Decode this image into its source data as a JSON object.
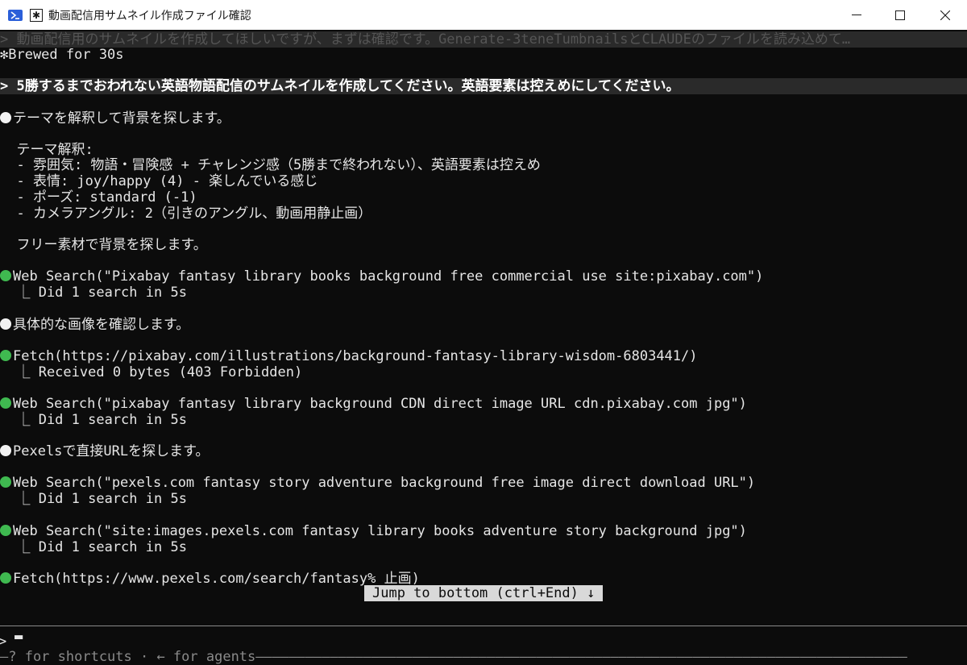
{
  "window": {
    "title": "動画配信用サムネイル作成ファイル確認",
    "app_icon_glyph": "✱",
    "minimize_label": "—",
    "maximize_label": "☐",
    "close_label": "✕"
  },
  "terminal": {
    "previous_prompt": "> 動画配信用のサムネイルを作成してほしいですが、まずは確認です。Generate-3teneTumbnailsとCLAUDEのファイルを読み込めて…",
    "brewed": "✻Brewed for 30s",
    "current_prompt": "> 5勝するまでおわれない英語物語配信のサムネイルを作成してください。英語要素は控えめにしてください。",
    "line_theme": "テーマを解釈して背景を探します。",
    "line_theme_header": "  テーマ解釈:",
    "line_theme_1": "  - 雰囲気: 物語・冒険感 + チャレンジ感（5勝まで終われない）、英語要素は控えめ",
    "line_theme_2": "  - 表情: joy/happy (4) - 楽しんでいる感じ",
    "line_theme_3": "  - ポーズ: standard (-1)",
    "line_theme_4": "  - カメラアングル: 2（引きのアングル、動画用静止画）",
    "line_free": "  フリー素材で背景を探します。",
    "ws1": "Web Search(\"Pixabay fantasy library books background free commercial use site:pixabay.com\")",
    "ws1_result": "  ⎿ Did 1 search in 5s",
    "line_check": "具体的な画像を確認します。",
    "fetch1": "Fetch(https://pixabay.com/illustrations/background-fantasy-library-wisdom-6803441/)",
    "fetch1_result": "  ⎿ Received 0 bytes (403 Forbidden)",
    "ws2": "Web Search(\"pixabay fantasy library background CDN direct image URL cdn.pixabay.com jpg\")",
    "ws2_result": "  ⎿ Did 1 search in 5s",
    "line_pexels": "Pexelsで直接URLを探します。",
    "ws3": "Web Search(\"pexels.com fantasy story adventure background free image direct download URL\")",
    "ws3_result": "  ⎿ Did 1 search in 5s",
    "ws4": "Web Search(\"site:images.pexels.com fantasy library books adventure story background jpg\")",
    "ws4_result": "  ⎿ Did 1 search in 5s",
    "fetch2": "Fetch(https://www.pexels.com/search/fantasy% 止画)",
    "jump": "Jump to bottom (ctrl+End) ↓",
    "input_prompt": "> ",
    "cursor": "▬",
    "footer": "—? for shortcuts · ← for agents———————————————————————————————————————————————————————————————————————————————"
  }
}
